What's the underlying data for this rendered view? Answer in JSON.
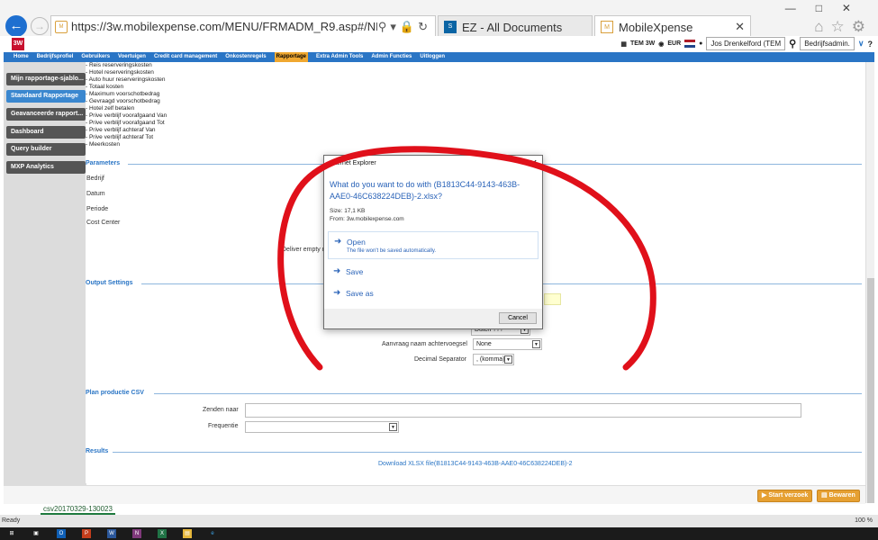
{
  "browser": {
    "url": "https://3w.mobilexpense.com/MENU/FRMADM_R9.asp#/NET/HomeADM/H",
    "tabs": [
      {
        "label": "EZ - All Documents"
      },
      {
        "label": "MobileXpense"
      }
    ]
  },
  "header": {
    "logo": "3W",
    "company": "TEM 3W",
    "currency": "EUR",
    "user": "Jos Drenkelford (TEM",
    "role": "Bedrijfsadmin.",
    "help": "?"
  },
  "menu": [
    "Home",
    "Bedrijfsprofiel",
    "Gebruikers",
    "Voertuigen",
    "Credit card management",
    "Onkostenregels",
    "Rapportage",
    "Extra Admin Tools",
    "Admin Functies",
    "Uitloggen"
  ],
  "menu_active": "Rapportage",
  "sidebar": [
    {
      "label": "Mijn rapportage-sjablo..."
    },
    {
      "label": "Standaard Rapportage"
    },
    {
      "label": "Geavanceerde rapport..."
    },
    {
      "label": "Dashboard"
    },
    {
      "label": "Query builder"
    },
    {
      "label": "MXP Analytics"
    }
  ],
  "kpi_list": [
    "- Reis reserveringskosten",
    "- Hotel reserveringskosten",
    "- Auto huur reserveringskosten",
    "- Totaal kosten",
    "- Maximum voorschotbedrag",
    "- Gevraagd voorschotbedrag",
    "- Hotel zelf betalen",
    "- Prive verblijf voorafgaand Van",
    "- Prive verblijf voorafgaand Tot",
    "- Prive verblijf achteraf Van",
    "- Prive verblijf achteraf Tot",
    "- Meerkosten"
  ],
  "parameters": {
    "title": "Parameters",
    "labels": [
      "Bedrijf",
      "Datum",
      "Periode",
      "Cost Center"
    ],
    "deliver_empty": "Deliver empty r"
  },
  "output": {
    "title": "Output Settings",
    "format_value": "Dutch ???",
    "suffix_label": "Aanvraag naam achtervoegsel",
    "suffix_value": "None",
    "decimal_label": "Decimal Separator",
    "decimal_value": ", (komma)"
  },
  "plan": {
    "title": "Plan productie CSV",
    "send_label": "Zenden naar",
    "freq_label": "Frequentie"
  },
  "results": {
    "title": "Results",
    "download": "Download XLSX file(B1813C44-9143-463B-AAE0-46C638224DEB)-2"
  },
  "buttons": {
    "start": "Start verzoek",
    "save": "Bewaren"
  },
  "excel_sheet": "csv20170329-130023",
  "status": {
    "ready": "Ready",
    "zoom": "100 %"
  },
  "dialog": {
    "title": "Internet Explorer",
    "question": "What do you want to do with (B1813C44-9143-463B-AAE0-46C638224DEB)-2.xlsx?",
    "size": "Size: 17,1 KB",
    "from": "From: 3w.mobilexpense.com",
    "open": "Open",
    "open_sub": "The file won't be saved automatically.",
    "save": "Save",
    "save_as": "Save as",
    "cancel": "Cancel"
  },
  "colors": {
    "brand_blue": "#2a75c5",
    "accent_orange": "#e6a032",
    "annotation_red": "#e0101a"
  }
}
